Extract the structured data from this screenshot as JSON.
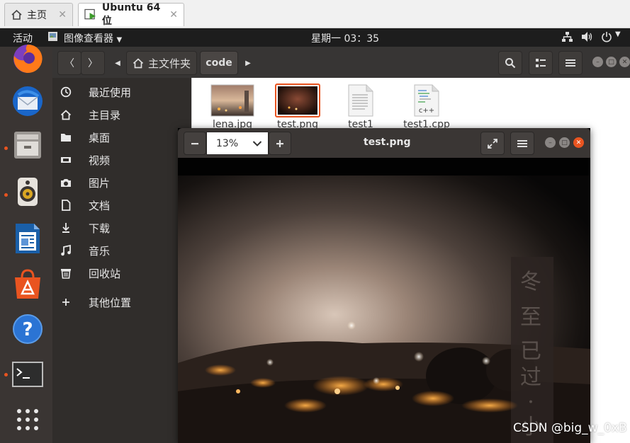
{
  "host_tabs": [
    {
      "label": "主页",
      "icon": "home-icon"
    },
    {
      "label": "Ubuntu 64 位",
      "icon": "vm-play-icon"
    }
  ],
  "topbar": {
    "activities": "活动",
    "app_menu": "图像查看器",
    "clock": "星期一 03：35"
  },
  "dock": [
    "firefox-icon",
    "thunderbird-icon",
    "files-icon",
    "rhythmbox-icon",
    "writer-icon",
    "software-icon",
    "help-icon",
    "terminal-icon",
    "app-grid-icon"
  ],
  "file_manager": {
    "path": {
      "home": "主文件夹",
      "current": "code"
    },
    "sidebar": [
      {
        "label": "最近使用",
        "icon": "clock-icon"
      },
      {
        "label": "主目录",
        "icon": "home-icon"
      },
      {
        "label": "桌面",
        "icon": "folder-icon"
      },
      {
        "label": "视频",
        "icon": "video-icon"
      },
      {
        "label": "图片",
        "icon": "camera-icon"
      },
      {
        "label": "文档",
        "icon": "document-icon"
      },
      {
        "label": "下载",
        "icon": "download-icon"
      },
      {
        "label": "音乐",
        "icon": "music-icon"
      },
      {
        "label": "回收站",
        "icon": "trash-icon"
      },
      {
        "label": "其他位置",
        "icon": "plus-icon"
      }
    ],
    "files": [
      {
        "name": "lena.jpg",
        "kind": "image"
      },
      {
        "name": "test.png",
        "kind": "image",
        "selected": true
      },
      {
        "name": "test1",
        "kind": "text"
      },
      {
        "name": "test1.cpp",
        "kind": "cpp",
        "badge": "c++"
      }
    ]
  },
  "viewer": {
    "title": "test.png",
    "zoom": "13%",
    "photo_text": "冬 至 已 过 · 小"
  },
  "watermark": "CSDN @big_w_0xB"
}
